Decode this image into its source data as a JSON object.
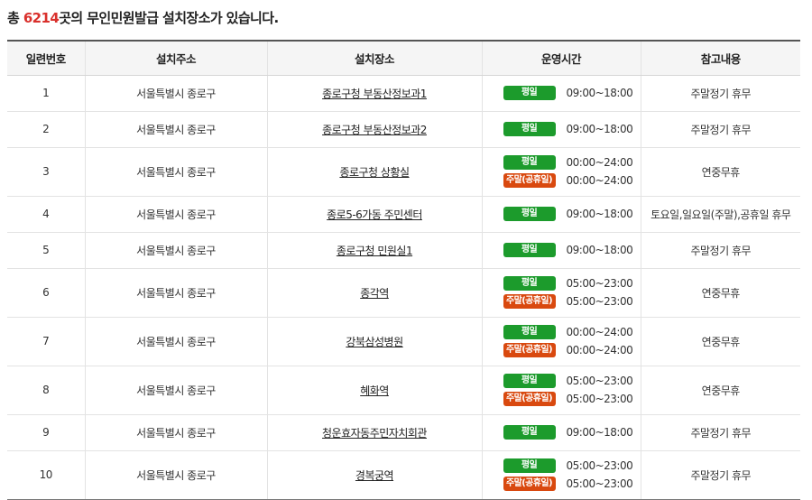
{
  "summary": {
    "prefix": "총 ",
    "count": "6214",
    "suffix": "곳의 무인민원발급 설치장소가 있습니다."
  },
  "colors": {
    "weekday_badge": "#1c9b2c",
    "weekend_badge": "#d9490f",
    "count_accent": "#d9302c"
  },
  "table": {
    "headers": [
      "일련번호",
      "설치주소",
      "설치장소",
      "운영시간",
      "참고내용"
    ],
    "rows": [
      {
        "no": "1",
        "address": "서울특별시 종로구",
        "location": "종로구청 부동산정보과1",
        "hours": [
          {
            "badge": "평일",
            "time": "09:00~18:00"
          }
        ],
        "note": "주말정기 휴무"
      },
      {
        "no": "2",
        "address": "서울특별시 종로구",
        "location": "종로구청 부동산정보과2",
        "hours": [
          {
            "badge": "평일",
            "time": "09:00~18:00"
          }
        ],
        "note": "주말정기 휴무"
      },
      {
        "no": "3",
        "address": "서울특별시 종로구",
        "location": "종로구청 상황실",
        "hours": [
          {
            "badge": "평일",
            "time": "00:00~24:00"
          },
          {
            "badge": "주말(공휴일)",
            "time": "00:00~24:00"
          }
        ],
        "note": "연중무휴"
      },
      {
        "no": "4",
        "address": "서울특별시 종로구",
        "location": "종로5-6가동 주민센터",
        "hours": [
          {
            "badge": "평일",
            "time": "09:00~18:00"
          }
        ],
        "note": "토요일,일요일(주말),공휴일 휴무"
      },
      {
        "no": "5",
        "address": "서울특별시 종로구",
        "location": "종로구청 민원실1",
        "hours": [
          {
            "badge": "평일",
            "time": "09:00~18:00"
          }
        ],
        "note": "주말정기 휴무"
      },
      {
        "no": "6",
        "address": "서울특별시 종로구",
        "location": "종각역",
        "hours": [
          {
            "badge": "평일",
            "time": "05:00~23:00"
          },
          {
            "badge": "주말(공휴일)",
            "time": "05:00~23:00"
          }
        ],
        "note": "연중무휴"
      },
      {
        "no": "7",
        "address": "서울특별시 종로구",
        "location": "강북삼성병원",
        "hours": [
          {
            "badge": "평일",
            "time": "00:00~24:00"
          },
          {
            "badge": "주말(공휴일)",
            "time": "00:00~24:00"
          }
        ],
        "note": "연중무휴"
      },
      {
        "no": "8",
        "address": "서울특별시 종로구",
        "location": "혜화역",
        "hours": [
          {
            "badge": "평일",
            "time": "05:00~23:00"
          },
          {
            "badge": "주말(공휴일)",
            "time": "05:00~23:00"
          }
        ],
        "note": "연중무휴"
      },
      {
        "no": "9",
        "address": "서울특별시 종로구",
        "location": "청운효자동주민자치회관",
        "hours": [
          {
            "badge": "평일",
            "time": "09:00~18:00"
          }
        ],
        "note": "주말정기 휴무"
      },
      {
        "no": "10",
        "address": "서울특별시 종로구",
        "location": "경복궁역",
        "hours": [
          {
            "badge": "평일",
            "time": "05:00~23:00"
          },
          {
            "badge": "주말(공휴일)",
            "time": "05:00~23:00"
          }
        ],
        "note": "주말정기 휴무"
      }
    ]
  }
}
